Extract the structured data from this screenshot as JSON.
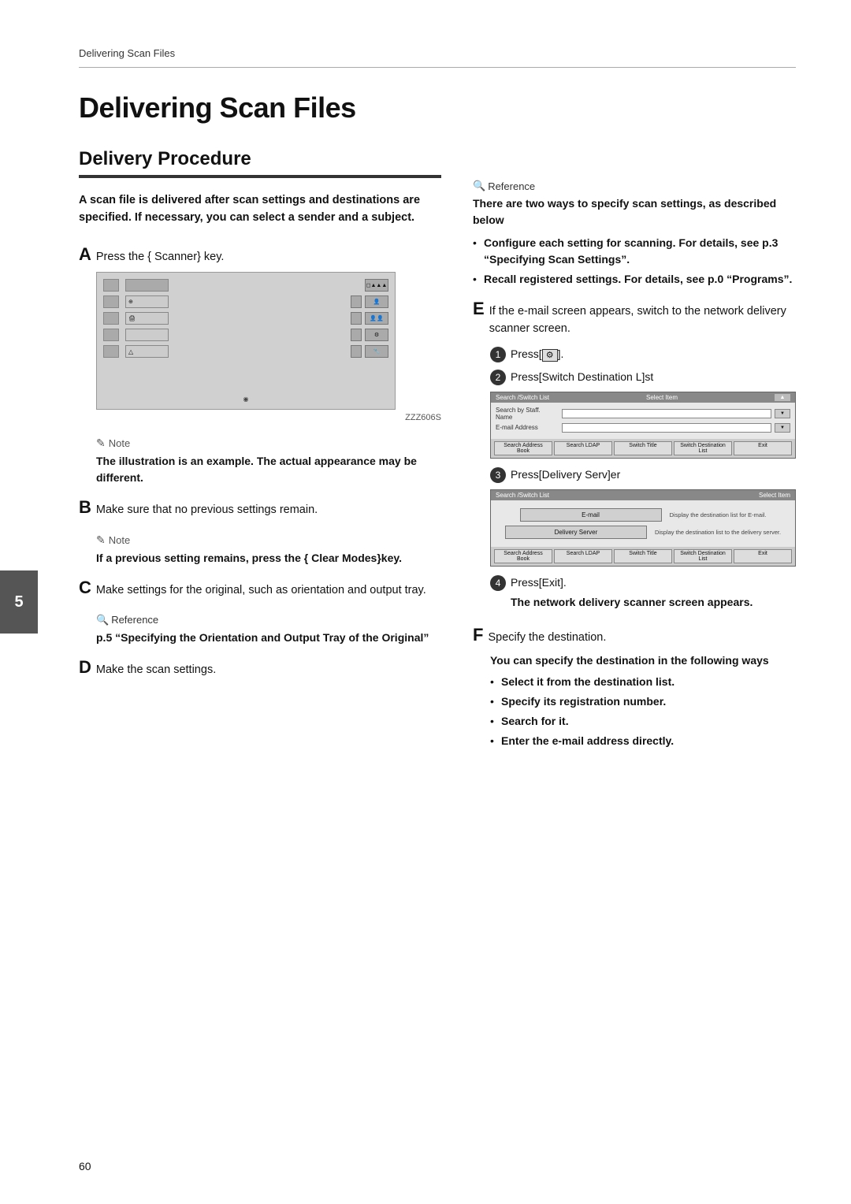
{
  "breadcrumb": "Delivering Scan Files",
  "page_title": "Delivering Scan Files",
  "section_heading": "Delivery Procedure",
  "intro": "A scan file is delivered after scan settings and destinations are specified. If necessary, you can select a sender and a subject.",
  "step_a": {
    "letter": "A",
    "text": "Press the { Scanner} key."
  },
  "step_a_image_caption": "ZZZ606S",
  "note1_label": "Note",
  "note1_text": "The illustration is an example. The actual appearance may be different.",
  "step_b": {
    "letter": "B",
    "text": "Make sure that no previous settings remain."
  },
  "note2_label": "Note",
  "note2_text": "If a previous setting remains, press the { Clear Modes}key.",
  "step_c": {
    "letter": "C",
    "text": "Make settings for the original, such as orientation and output tray."
  },
  "ref1_label": "Reference",
  "ref1_text": "p.5 “Specifying the Orientation and Output Tray of the Original”",
  "step_d": {
    "letter": "D",
    "text": "Make the scan settings."
  },
  "ref2_label": "Reference",
  "ref2_intro": "There are two ways to specify scan settings, as described below",
  "ref2_bullet1": "Configure each setting for scanning. For details, see p.3 “Specifying Scan Settings”.",
  "ref2_bullet2": "Recall registered settings. For details, see p.0 “Programs”.",
  "step_e": {
    "letter": "E",
    "text": "If the e-mail screen appears, switch to the network delivery scanner screen."
  },
  "sub1_num": "1",
  "sub1_text": "Press[     ].",
  "sub2_num": "2",
  "sub2_text": "Press[Switch Destination L]st",
  "screen1_header_left": "Search /Switch List",
  "screen1_header_right": "Select Item",
  "screen1_row1": "Search by Staff. Name",
  "screen1_row2": "E-mail Address",
  "screen1_footer": [
    "Search Address Book",
    "Search LDAP",
    "Switch Title",
    "Switch Destination List",
    "Exit"
  ],
  "sub3_num": "3",
  "sub3_text": "Press[Delivery Serv]er",
  "screen2_btn1": "E-mail",
  "screen2_desc1": "Display the destination list for E-mail.",
  "screen2_btn2": "Delivery Server",
  "screen2_desc2": "Display the destination list to the delivery server.",
  "screen2_footer": [
    "Search Address Book",
    "Search LDAP",
    "Switch Title",
    "Switch Destination List",
    "Exit"
  ],
  "sub4_num": "4",
  "sub4_text": "Press[Exit].",
  "sub4_note": "The network delivery scanner screen appears.",
  "step_f": {
    "letter": "F",
    "text": "Specify the destination."
  },
  "step_f_bold": "You can specify the destination in the following ways",
  "step_f_bullets": [
    "Select it from the destination list.",
    "Specify its registration number.",
    "Search for it.",
    "Enter the e-mail address directly."
  ],
  "page_number": "60",
  "side_tab": "5"
}
